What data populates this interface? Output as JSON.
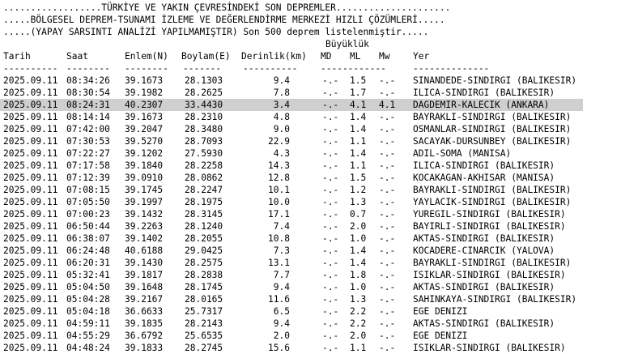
{
  "header": {
    "line1": "..................TÜRKİYE VE YAKIN ÇEVRESİNDEKİ SON DEPREMLER.....................",
    "line2": ".....BÖLGESEL DEPREM-TSUNAMI İZLEME VE DEĞERLENDİRME MERKEZİ HIZLI ÇÖZÜMLERİ.....",
    "line3": ".....(YAPAY SARSINTI ANALİZİ YAPILMAMIŞTIR) Son 500 deprem listelenmiştir.....",
    "magnitude_group": "Büyüklük"
  },
  "columns": {
    "date": "Tarih",
    "time": "Saat",
    "lat": "Enlem(N)",
    "lon": "Boylam(E)",
    "depth": "Derinlik(km)",
    "md": "MD",
    "ml": "ML",
    "mw": "Mw",
    "place": "Yer"
  },
  "separators": {
    "date": "----------",
    "time": "--------",
    "lat": "--------",
    "lon": "-------",
    "depth": "----------",
    "mag": "------------",
    "place": "--------------"
  },
  "rows": [
    {
      "date": "2025.09.11",
      "time": "08:34:26",
      "lat": "39.1673",
      "lon": "28.1303",
      "depth": "9.4",
      "md": "-.-",
      "ml": "1.5",
      "mw": "-.-",
      "place": "SINANDEDE-SINDIRGI (BALIKESIR)"
    },
    {
      "date": "2025.09.11",
      "time": "08:30:54",
      "lat": "39.1982",
      "lon": "28.2625",
      "depth": "7.8",
      "md": "-.-",
      "ml": "1.7",
      "mw": "-.-",
      "place": "ILICA-SINDIRGI (BALIKESIR)"
    },
    {
      "date": "2025.09.11",
      "time": "08:24:31",
      "lat": "40.2307",
      "lon": "33.4430",
      "depth": "3.4",
      "md": "-.-",
      "ml": "4.1",
      "mw": "4.1",
      "place": "DAGDEMIR-KALECIK (ANKARA)"
    },
    {
      "date": "2025.09.11",
      "time": "08:14:14",
      "lat": "39.1673",
      "lon": "28.2310",
      "depth": "4.8",
      "md": "-.-",
      "ml": "1.4",
      "mw": "-.-",
      "place": "BAYRAKLI-SINDIRGI (BALIKESIR)"
    },
    {
      "date": "2025.09.11",
      "time": "07:42:00",
      "lat": "39.2047",
      "lon": "28.3480",
      "depth": "9.0",
      "md": "-.-",
      "ml": "1.4",
      "mw": "-.-",
      "place": "OSMANLAR-SINDIRGI (BALIKESIR)"
    },
    {
      "date": "2025.09.11",
      "time": "07:30:53",
      "lat": "39.5270",
      "lon": "28.7093",
      "depth": "22.9",
      "md": "-.-",
      "ml": "1.1",
      "mw": "-.-",
      "place": "SACAYAK-DURSUNBEY (BALIKESIR)"
    },
    {
      "date": "2025.09.11",
      "time": "07:22:27",
      "lat": "39.1202",
      "lon": "27.5930",
      "depth": "4.3",
      "md": "-.-",
      "ml": "1.4",
      "mw": "-.-",
      "place": "ADIL-SOMA (MANISA)"
    },
    {
      "date": "2025.09.11",
      "time": "07:17:58",
      "lat": "39.1840",
      "lon": "28.2258",
      "depth": "14.3",
      "md": "-.-",
      "ml": "1.1",
      "mw": "-.-",
      "place": "ILICA-SINDIRGI (BALIKESIR)"
    },
    {
      "date": "2025.09.11",
      "time": "07:12:39",
      "lat": "39.0910",
      "lon": "28.0862",
      "depth": "12.8",
      "md": "-.-",
      "ml": "1.5",
      "mw": "-.-",
      "place": "KOCAKAGAN-AKHISAR (MANISA)"
    },
    {
      "date": "2025.09.11",
      "time": "07:08:15",
      "lat": "39.1745",
      "lon": "28.2247",
      "depth": "10.1",
      "md": "-.-",
      "ml": "1.2",
      "mw": "-.-",
      "place": "BAYRAKLI-SINDIRGI (BALIKESIR)"
    },
    {
      "date": "2025.09.11",
      "time": "07:05:50",
      "lat": "39.1997",
      "lon": "28.1975",
      "depth": "10.0",
      "md": "-.-",
      "ml": "1.3",
      "mw": "-.-",
      "place": "YAYLACIK-SINDIRGI (BALIKESIR)"
    },
    {
      "date": "2025.09.11",
      "time": "07:00:23",
      "lat": "39.1432",
      "lon": "28.3145",
      "depth": "17.1",
      "md": "-.-",
      "ml": "0.7",
      "mw": "-.-",
      "place": "YUREGIL-SINDIRGI (BALIKESIR)"
    },
    {
      "date": "2025.09.11",
      "time": "06:50:44",
      "lat": "39.2263",
      "lon": "28.1240",
      "depth": "7.4",
      "md": "-.-",
      "ml": "2.0",
      "mw": "-.-",
      "place": "BAYIRLI-SINDIRGI (BALIKESIR)"
    },
    {
      "date": "2025.09.11",
      "time": "06:38:07",
      "lat": "39.1402",
      "lon": "28.2055",
      "depth": "10.8",
      "md": "-.-",
      "ml": "1.0",
      "mw": "-.-",
      "place": "AKTAS-SINDIRGI (BALIKESIR)"
    },
    {
      "date": "2025.09.11",
      "time": "06:24:48",
      "lat": "40.6188",
      "lon": "29.0425",
      "depth": "7.3",
      "md": "-.-",
      "ml": "1.4",
      "mw": "-.-",
      "place": "KOCADERE-CINARCIK (YALOVA)"
    },
    {
      "date": "2025.09.11",
      "time": "06:20:31",
      "lat": "39.1430",
      "lon": "28.2575",
      "depth": "13.1",
      "md": "-.-",
      "ml": "1.4",
      "mw": "-.-",
      "place": "BAYRAKLI-SINDIRGI (BALIKESIR)"
    },
    {
      "date": "2025.09.11",
      "time": "05:32:41",
      "lat": "39.1817",
      "lon": "28.2838",
      "depth": "7.7",
      "md": "-.-",
      "ml": "1.8",
      "mw": "-.-",
      "place": "ISIKLAR-SINDIRGI (BALIKESIR)"
    },
    {
      "date": "2025.09.11",
      "time": "05:04:50",
      "lat": "39.1648",
      "lon": "28.1745",
      "depth": "9.4",
      "md": "-.-",
      "ml": "1.0",
      "mw": "-.-",
      "place": "AKTAS-SINDIRGI (BALIKESIR)"
    },
    {
      "date": "2025.09.11",
      "time": "05:04:28",
      "lat": "39.2167",
      "lon": "28.0165",
      "depth": "11.6",
      "md": "-.-",
      "ml": "1.3",
      "mw": "-.-",
      "place": "SAHINKAYA-SINDIRGI (BALIKESIR)"
    },
    {
      "date": "2025.09.11",
      "time": "05:04:18",
      "lat": "36.6633",
      "lon": "25.7317",
      "depth": "6.5",
      "md": "-.-",
      "ml": "2.2",
      "mw": "-.-",
      "place": "EGE DENIZI"
    },
    {
      "date": "2025.09.11",
      "time": "04:59:11",
      "lat": "39.1835",
      "lon": "28.2143",
      "depth": "9.4",
      "md": "-.-",
      "ml": "2.2",
      "mw": "-.-",
      "place": "AKTAS-SINDIRGI (BALIKESIR)"
    },
    {
      "date": "2025.09.11",
      "time": "04:55:29",
      "lat": "36.6792",
      "lon": "25.6535",
      "depth": "2.0",
      "md": "-.-",
      "ml": "2.0",
      "mw": "-.-",
      "place": "EGE DENIZI"
    },
    {
      "date": "2025.09.11",
      "time": "04:48:24",
      "lat": "39.1833",
      "lon": "28.2745",
      "depth": "15.6",
      "md": "-.-",
      "ml": "1.1",
      "mw": "-.-",
      "place": "ISIKLAR-SINDIRGI (BALIKESIR)"
    }
  ],
  "highlighted_row_index": 2,
  "colors": {
    "background": "#ffffff",
    "text": "#000000",
    "highlight": "#cfcfcf"
  }
}
